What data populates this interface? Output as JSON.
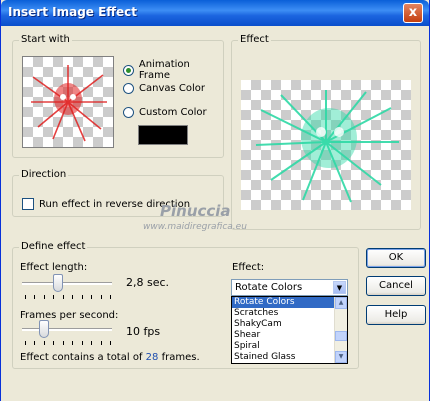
{
  "window": {
    "title": "Insert Image Effect",
    "close_glyph": "x"
  },
  "start_with": {
    "label": "Start with",
    "options": [
      "Animation Frame",
      "Canvas Color",
      "Custom Color"
    ],
    "selected": "Animation Frame",
    "custom_color": "#000000"
  },
  "effect_preview": {
    "label": "Effect"
  },
  "direction": {
    "label": "Direction",
    "reverse_label": "Run effect in reverse direction",
    "reverse_checked": false
  },
  "define_effect": {
    "label": "Define effect",
    "length_label": "Effect length:",
    "length_value": "2,8 sec.",
    "fps_label": "Frames per second:",
    "fps_value": "10 fps",
    "total_prefix": "Effect contains a total of",
    "total_frames": "28",
    "total_suffix": "frames."
  },
  "effect_select": {
    "label": "Effect:",
    "value": "Rotate Colors",
    "list": [
      "Rotate Colors",
      "Scratches",
      "ShakyCam",
      "Shear",
      "Spiral",
      "Stained Glass"
    ],
    "selected_index": 0
  },
  "buttons": {
    "ok": "OK",
    "cancel": "Cancel",
    "help": "Help"
  },
  "watermark": {
    "name": "Pinuccia",
    "site": "www.maidiregrafica.eu"
  },
  "colors": {
    "preview_start": "#e02020",
    "preview_effect": "#2fd9a6"
  }
}
